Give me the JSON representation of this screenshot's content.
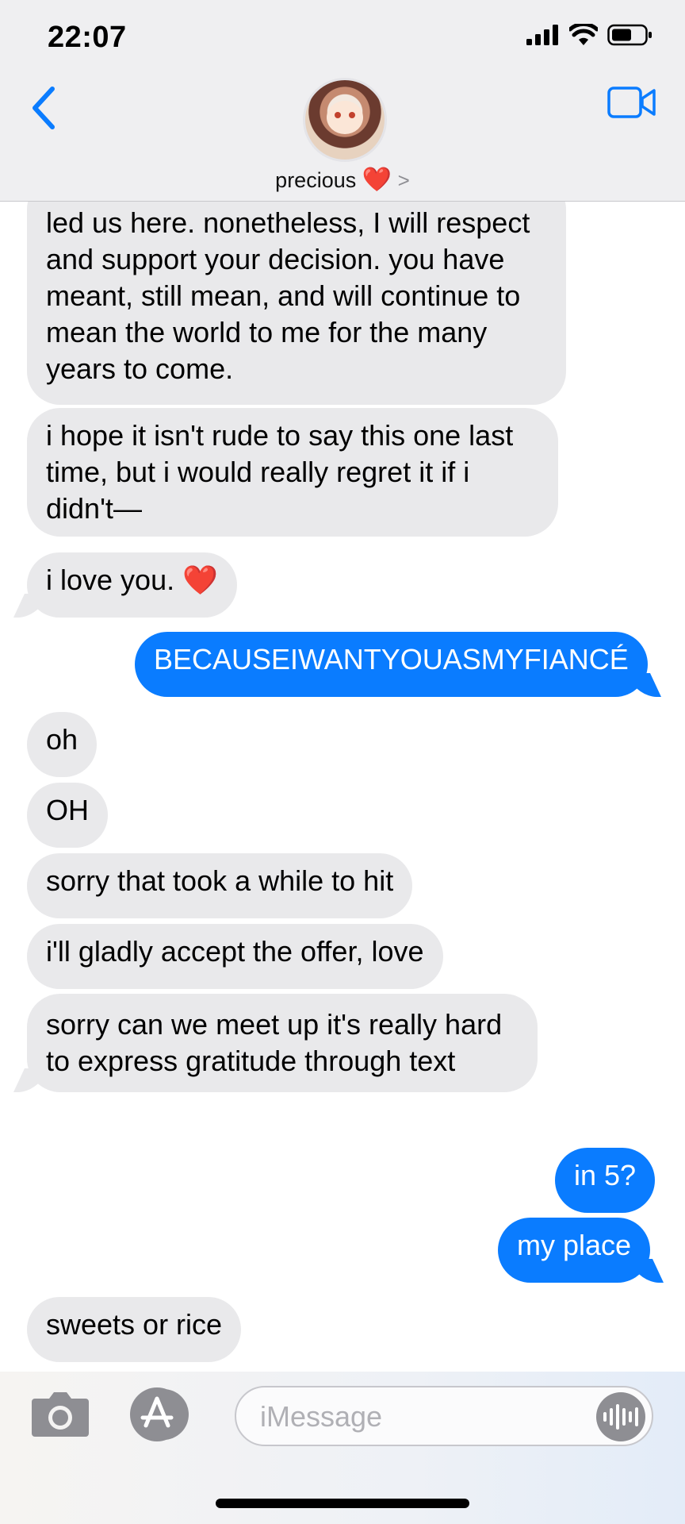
{
  "status": {
    "time": "22:07"
  },
  "contact": {
    "name": "precious",
    "heart": "❤️",
    "chevron": ">"
  },
  "messages": [
    {
      "from": "them",
      "text": "led us here. nonetheless, I will respect and support your decision. you have meant, still mean, and will continue to mean the world to me for the many years to come."
    },
    {
      "from": "them",
      "text": "i hope it isn't rude to say this one last time, but i would really regret it if i didn't—"
    },
    {
      "from": "them",
      "text": "i love you. ",
      "emoji": "❤️"
    },
    {
      "from": "me",
      "text": "BECAUSEIWANTYOUASMYFIANCÉ"
    },
    {
      "from": "them",
      "text": "oh"
    },
    {
      "from": "them",
      "text": "OH"
    },
    {
      "from": "them",
      "text": "sorry that took a while to hit"
    },
    {
      "from": "them",
      "text": "i'll gladly accept the offer, love"
    },
    {
      "from": "them",
      "text": "sorry can we meet up it's really hard to express gratitude through text"
    },
    {
      "from": "me",
      "text": "in 5?"
    },
    {
      "from": "me",
      "text": "my place"
    },
    {
      "from": "them",
      "text": "sweets or rice"
    }
  ],
  "input": {
    "placeholder": "iMessage"
  },
  "colors": {
    "accent": "#0a7cff",
    "incoming": "#e9e9eb",
    "heart": "#e1262b"
  },
  "icons": [
    "back-chevron-icon",
    "video-call-icon",
    "camera-icon",
    "app-store-icon",
    "audio-waveform-icon",
    "signal-icon",
    "wifi-icon",
    "battery-icon"
  ]
}
